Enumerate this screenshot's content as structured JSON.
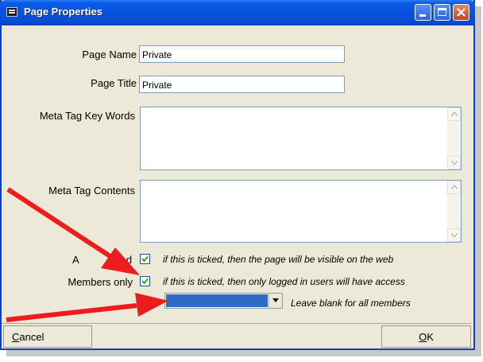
{
  "window": {
    "title": "Page Properties",
    "controls": [
      "minimize-icon",
      "maximize-icon",
      "close-icon"
    ]
  },
  "form": {
    "page_name_label": "Page Name",
    "page_name_value": "Private",
    "page_title_label": "Page Title",
    "page_title_value": "Private",
    "meta_keywords_label": "Meta Tag Key Words",
    "meta_keywords_value": "",
    "meta_contents_label": "Meta Tag Contents",
    "meta_contents_value": "",
    "activated_label_visible": "A",
    "activated_label_tail": "ted",
    "activated_checked": true,
    "activated_hint": "if this is ticked, then the page will be visible on the web",
    "members_only_label": "Members only",
    "members_only_checked": true,
    "members_only_hint": "if this is ticked, then only logged in users will have access",
    "member_group_value": "",
    "member_group_hint": "Leave blank for all members"
  },
  "buttons": {
    "cancel_first": "C",
    "cancel_rest": "ancel",
    "ok_first": "O",
    "ok_rest": "K"
  },
  "colors": {
    "titlebar": "#0852e0",
    "dialog_bg": "#ece9d8",
    "arrow": "#ee1c1c",
    "selection": "#316ac5"
  }
}
